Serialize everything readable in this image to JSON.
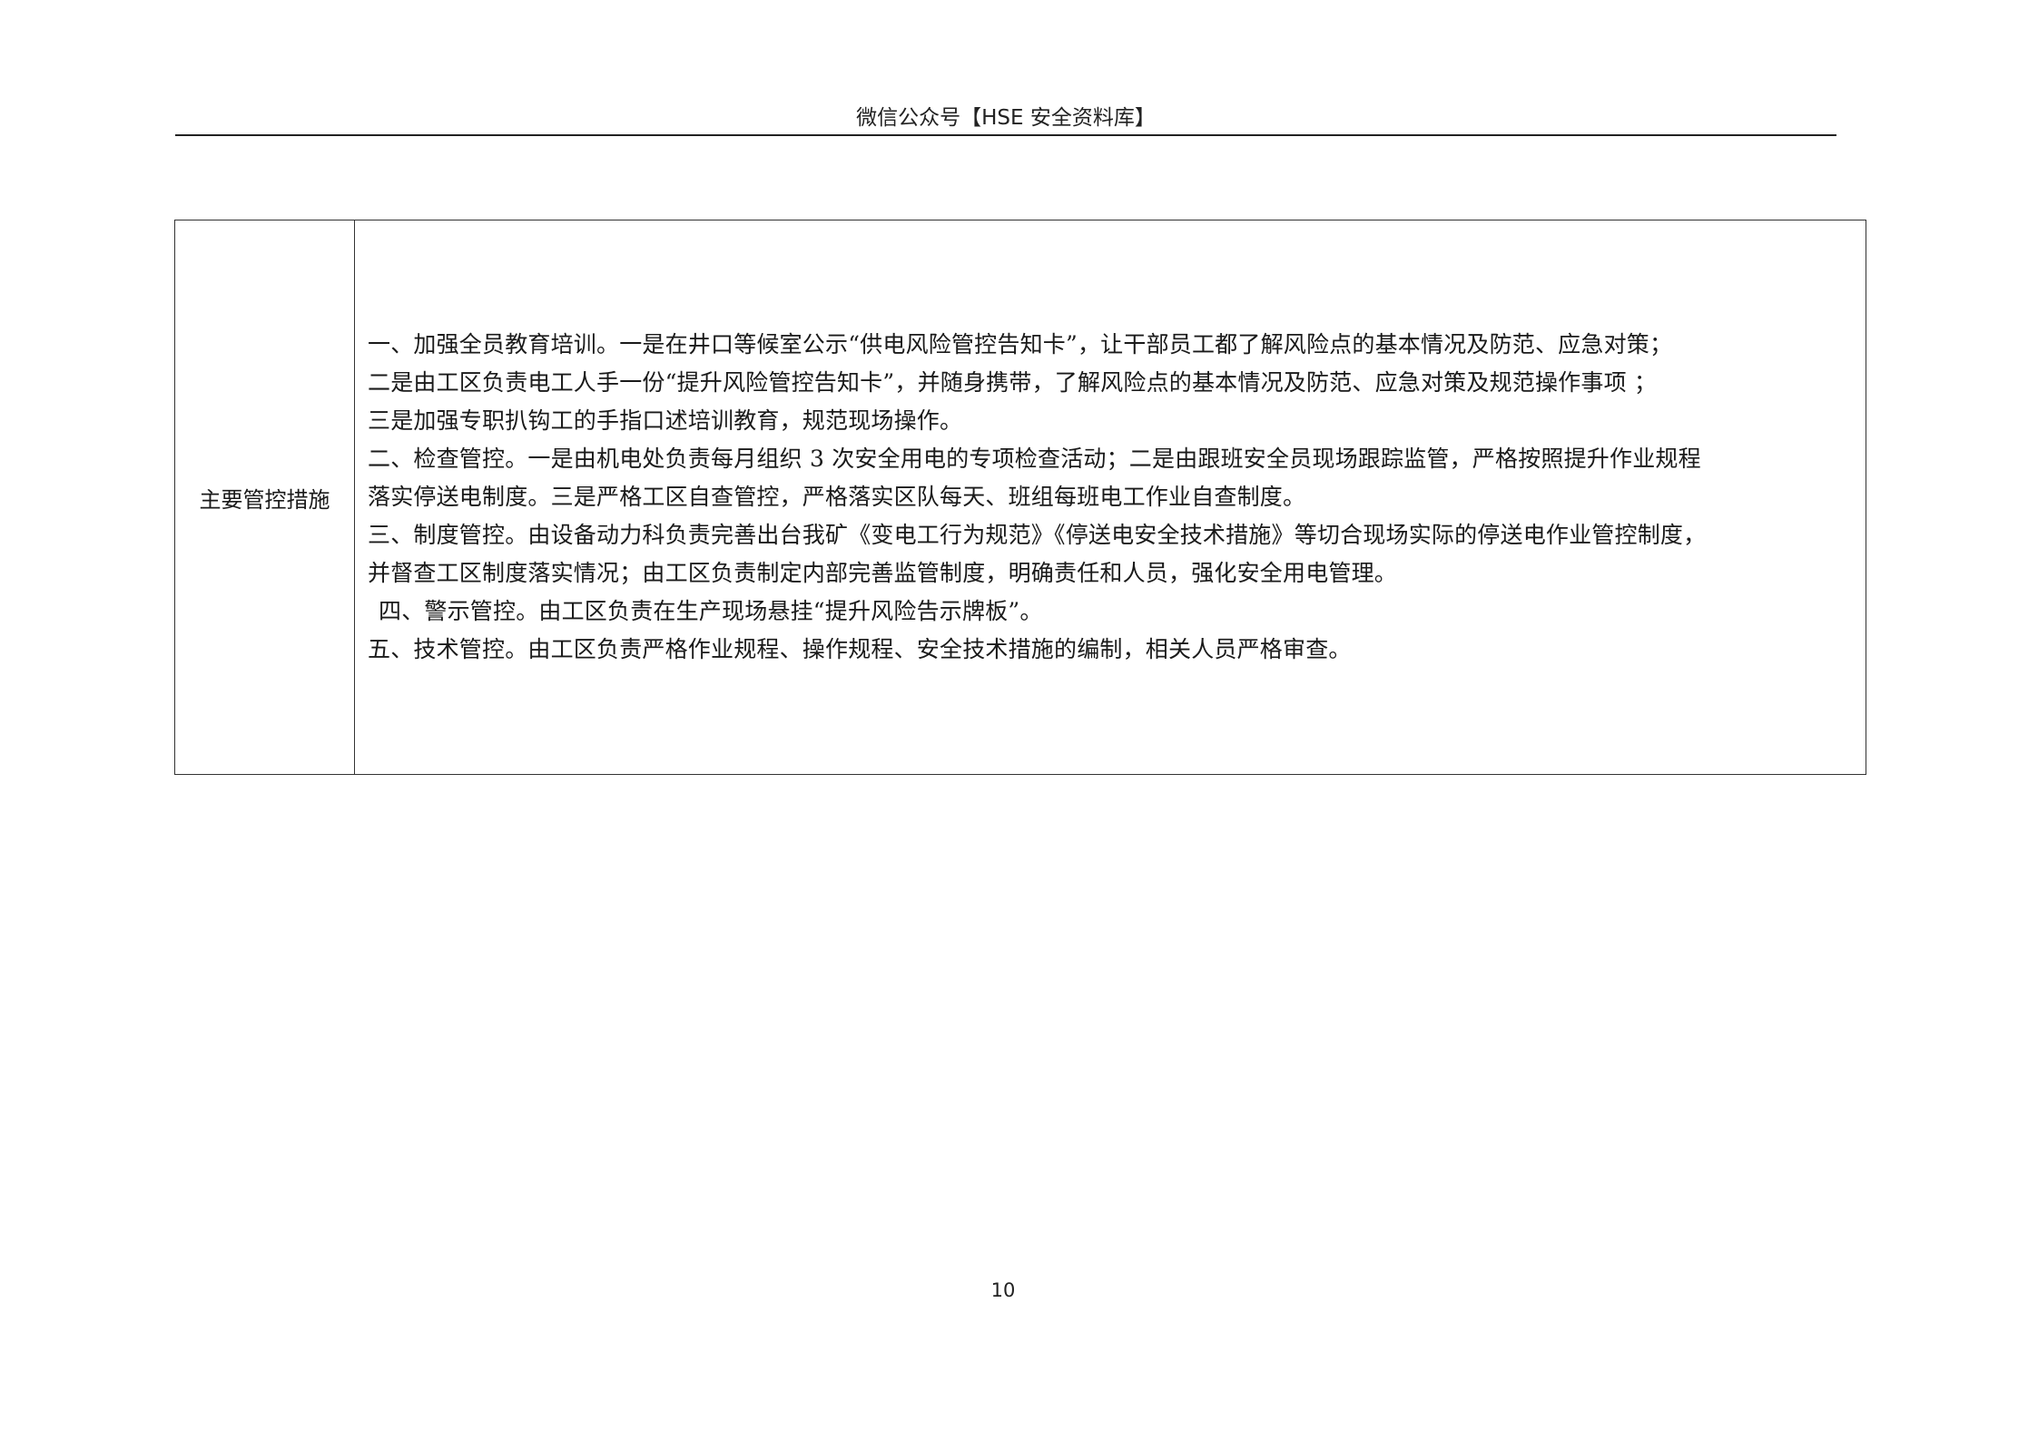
{
  "header": {
    "title": "微信公众号【HSE 安全资料库】"
  },
  "table": {
    "label": "主要管控措施",
    "paragraphs": [
      "一、加强全员教育培训。一是在井口等候室公示“供电风险管控告知卡”，让干部员工都了解风险点的基本情况及防范、应急对策；",
      "二是由工区负责电工人手一份“提升风险管控告知卡”，并随身携带，了解风险点的基本情况及防范、应急对策及规范操作事项 ；",
      "三是加强专职扒钩工的手指口述培训教育，规范现场操作。",
      "二、检查管控。一是由机电处负责每月组织 3 次安全用电的专项检查活动；二是由跟班安全员现场跟踪监管，严格按照提升作业规程",
      "落实停送电制度。三是严格工区自查管控，严格落实区队每天、班组每班电工作业自查制度。",
      "三、制度管控。由设备动力科负责完善出台我矿《变电工行为规范》《停送电安全技术措施》等切合现场实际的停送电作业管控制度，",
      "并督查工区制度落实情况；由工区负责制定内部完善监管制度，明确责任和人员，强化安全用电管理。",
      "四、警示管控。由工区负责在生产现场悬挂“提升风险告示牌板”。",
      "五、技术管控。由工区负责严格作业规程、操作规程、安全技术措施的编制，相关人员严格审查。"
    ]
  },
  "footer": {
    "page_number": "10"
  }
}
